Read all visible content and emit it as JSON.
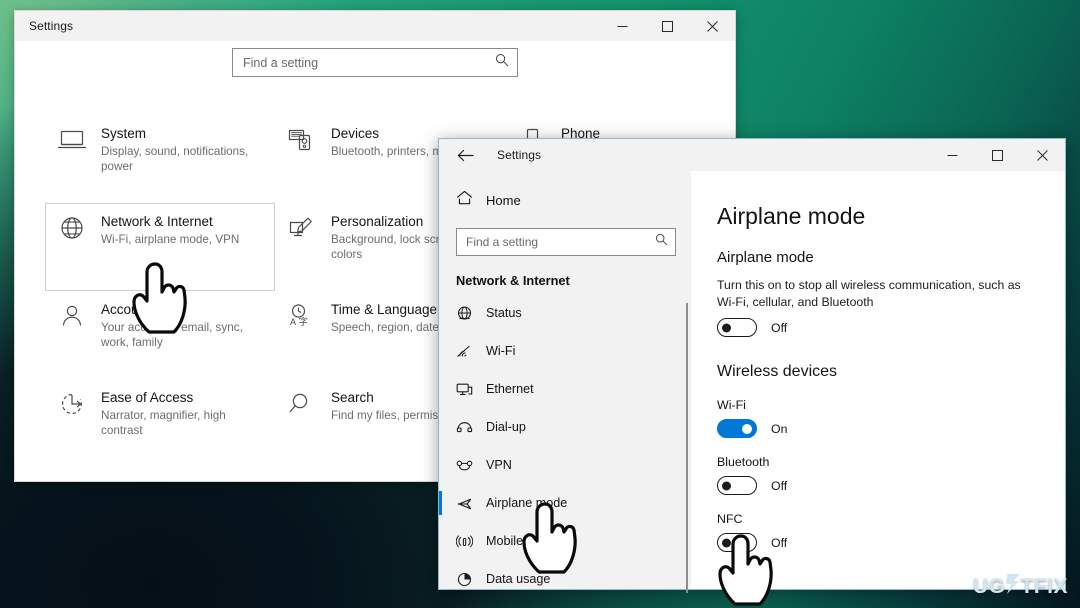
{
  "desktop": {
    "background_colors": [
      "#4dba8c",
      "#14936f",
      "#04161f"
    ],
    "watermark": {
      "text_before": "UG",
      "bolt": "⚡",
      "text_after": "TFIX"
    }
  },
  "back_window": {
    "title": "Settings",
    "controls": {
      "minimize": "minimize-icon",
      "maximize": "maximize-icon",
      "close": "close-icon"
    },
    "search": {
      "placeholder": "Find a setting",
      "icon": "search-icon"
    },
    "categories": [
      {
        "icon": "laptop-icon",
        "name": "System",
        "desc": "Display, sound, notifications, power",
        "selected": false
      },
      {
        "icon": "devices-icon",
        "name": "Devices",
        "desc": "Bluetooth, printers, mouse",
        "selected": false
      },
      {
        "icon": "phone-icon",
        "name": "Phone",
        "desc": "",
        "selected": false
      },
      {
        "icon": "globe-icon",
        "name": "Network & Internet",
        "desc": "Wi-Fi, airplane mode, VPN",
        "selected": true
      },
      {
        "icon": "paintbrush-icon",
        "name": "Personalization",
        "desc": "Background, lock screen, colors",
        "selected": false
      },
      {
        "icon": "apps-icon",
        "name": "",
        "desc": "",
        "selected": false
      },
      {
        "icon": "person-icon",
        "name": "Accounts",
        "desc": "Your accounts, email, sync, work, family",
        "selected": false
      },
      {
        "icon": "clock-language-icon",
        "name": "Time & Language",
        "desc": "Speech, region, date",
        "selected": false
      },
      {
        "icon": "game-icon",
        "name": "",
        "desc": "",
        "selected": false
      },
      {
        "icon": "ease-of-access-icon",
        "name": "Ease of Access",
        "desc": "Narrator, magnifier, high contrast",
        "selected": false
      },
      {
        "icon": "magnifier-icon",
        "name": "Search",
        "desc": "Find my files, permissions",
        "selected": false
      },
      {
        "icon": "blank-icon",
        "name": "",
        "desc": "",
        "selected": false
      }
    ]
  },
  "front_window": {
    "title": "Settings",
    "back_icon": "back-arrow-icon",
    "controls": {
      "minimize": "minimize-icon",
      "maximize": "maximize-icon",
      "close": "close-icon"
    },
    "nav": {
      "home_label": "Home",
      "home_icon": "home-icon",
      "search": {
        "placeholder": "Find a setting",
        "icon": "search-icon"
      },
      "group_header": "Network & Internet",
      "items": [
        {
          "icon": "status-globe-icon",
          "label": "Status",
          "active": false
        },
        {
          "icon": "wifi-icon",
          "label": "Wi-Fi",
          "active": false
        },
        {
          "icon": "ethernet-icon",
          "label": "Ethernet",
          "active": false
        },
        {
          "icon": "dialup-icon",
          "label": "Dial-up",
          "active": false
        },
        {
          "icon": "vpn-icon",
          "label": "VPN",
          "active": false
        },
        {
          "icon": "airplane-icon",
          "label": "Airplane mode",
          "active": true
        },
        {
          "icon": "hotspot-icon",
          "label": "Mobile hotspot",
          "active": false
        },
        {
          "icon": "data-usage-icon",
          "label": "Data usage",
          "active": false
        }
      ]
    },
    "content": {
      "page_title": "Airplane mode",
      "section_title": "Airplane mode",
      "description": "Turn this on to stop all wireless communication, such as Wi-Fi, cellular, and Bluetooth",
      "airplane_toggle": {
        "state": "Off",
        "on": false
      },
      "group_title": "Wireless devices",
      "devices": [
        {
          "label": "Wi-Fi",
          "state": "On",
          "on": true
        },
        {
          "label": "Bluetooth",
          "state": "Off",
          "on": false
        },
        {
          "label": "NFC",
          "state": "Off",
          "on": false
        }
      ]
    }
  },
  "cursors": [
    {
      "name": "hand-cursor-network-internet"
    },
    {
      "name": "hand-cursor-airplane-mode"
    },
    {
      "name": "hand-cursor-nfc-toggle"
    }
  ],
  "accent_color": "#0078d7"
}
